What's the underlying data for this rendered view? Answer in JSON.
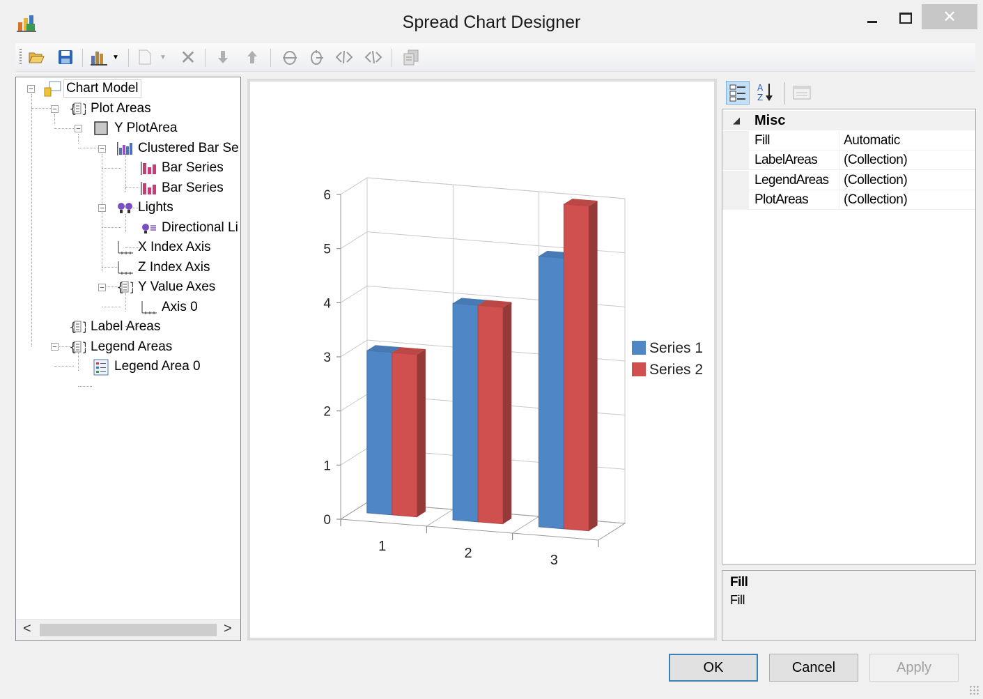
{
  "window": {
    "title": "Spread Chart Designer",
    "minimize_label": "–",
    "maximize_label": "☐",
    "close_label": "✕"
  },
  "toolbar": {
    "buttons": [
      "open-icon",
      "save-icon",
      "chart-type-icon",
      "dropdown-icon",
      "new-icon",
      "dropdown-icon",
      "delete-icon",
      "move-down-icon",
      "move-up-icon",
      "rotate-x-icon",
      "rotate-y-icon",
      "rotate-z-left-icon",
      "rotate-z-right-icon",
      "copy-icon"
    ]
  },
  "tree": {
    "nodes": [
      {
        "label": "Chart Model",
        "icon": "chart-model-icon",
        "expanded": true
      },
      {
        "label": "Plot Areas",
        "icon": "collection-icon",
        "expanded": true
      },
      {
        "label": "Y PlotArea",
        "icon": "plot-area-icon",
        "expanded": true
      },
      {
        "label": "Clustered Bar Se",
        "icon": "bar-series-icon",
        "expanded": true
      },
      {
        "label": "Bar Series",
        "icon": "bar-icon"
      },
      {
        "label": "Bar Series",
        "icon": "bar-icon"
      },
      {
        "label": "Lights",
        "icon": "lights-icon",
        "expanded": true
      },
      {
        "label": "Directional Li",
        "icon": "light-icon"
      },
      {
        "label": "X Index Axis",
        "icon": "axis-icon"
      },
      {
        "label": "Z Index Axis",
        "icon": "axis-icon"
      },
      {
        "label": "Y Value Axes",
        "icon": "collection-icon",
        "expanded": true
      },
      {
        "label": "Axis 0",
        "icon": "axis-icon"
      },
      {
        "label": "Label Areas",
        "icon": "collection-icon"
      },
      {
        "label": "Legend Areas",
        "icon": "collection-icon",
        "expanded": true
      },
      {
        "label": "Legend Area 0",
        "icon": "legend-icon"
      }
    ],
    "scroll_left": "<",
    "scroll_right": ">"
  },
  "chart_data": {
    "type": "bar",
    "categories": [
      "1",
      "2",
      "3"
    ],
    "series": [
      {
        "name": "Series 1",
        "values": [
          3,
          4,
          5
        ],
        "color": "#4f86c6"
      },
      {
        "name": "Series 2",
        "values": [
          3,
          4,
          6
        ],
        "color": "#d04f4f"
      }
    ],
    "ylim": [
      0,
      6
    ],
    "yticks": [
      "0",
      "1",
      "2",
      "3",
      "4",
      "5",
      "6"
    ],
    "grid": true,
    "three_d": true,
    "legend": "right"
  },
  "property_grid": {
    "category": "Misc",
    "rows": [
      {
        "name": "Fill",
        "value": "Automatic"
      },
      {
        "name": "LabelAreas",
        "value": "(Collection)"
      },
      {
        "name": "LegendAreas",
        "value": "(Collection)"
      },
      {
        "name": "PlotAreas",
        "value": "(Collection)"
      }
    ],
    "description_title": "Fill",
    "description_text": "Fill"
  },
  "buttons": {
    "ok": "OK",
    "cancel": "Cancel",
    "apply": "Apply"
  }
}
